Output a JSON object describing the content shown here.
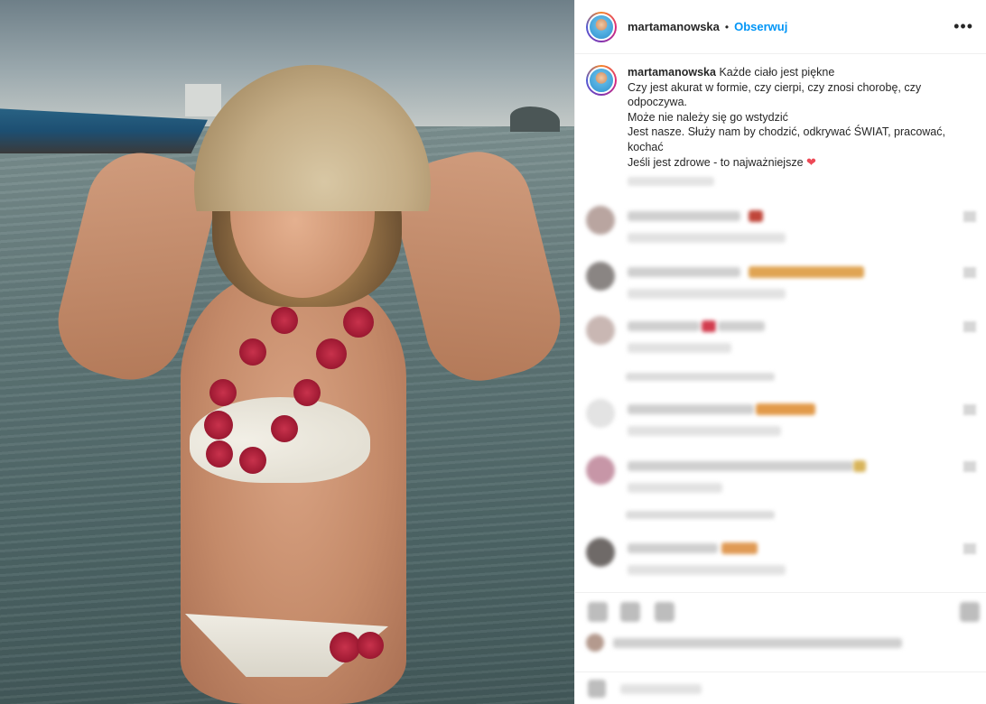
{
  "post": {
    "username": "martamanowska",
    "separator": "•",
    "follow_label": "Obserwuj",
    "more_label": "•••",
    "caption": {
      "username": "martamanowska",
      "lines": [
        "Każde ciało jest piękne",
        "Czy jest akurat w formie, czy cierpi, czy znosi chorobę, czy odpoczywa.",
        "Może nie należy się go wstydzić",
        "Jest nasze. Służy nam by chodzić, odkrywać ŚWIAT, pracować, kochać",
        "Jeśli jest zdrowe - to najważniejsze"
      ],
      "heart": "❤"
    }
  },
  "colors": {
    "accent": "#0095f6",
    "heart": "#ed4956",
    "text": "#262626",
    "divider": "#efefef"
  },
  "icons": {
    "more": "more-options-icon",
    "heart": "heart-emoji-icon",
    "like": "like-icon",
    "comment": "comment-icon",
    "share": "share-icon",
    "save": "save-icon"
  }
}
